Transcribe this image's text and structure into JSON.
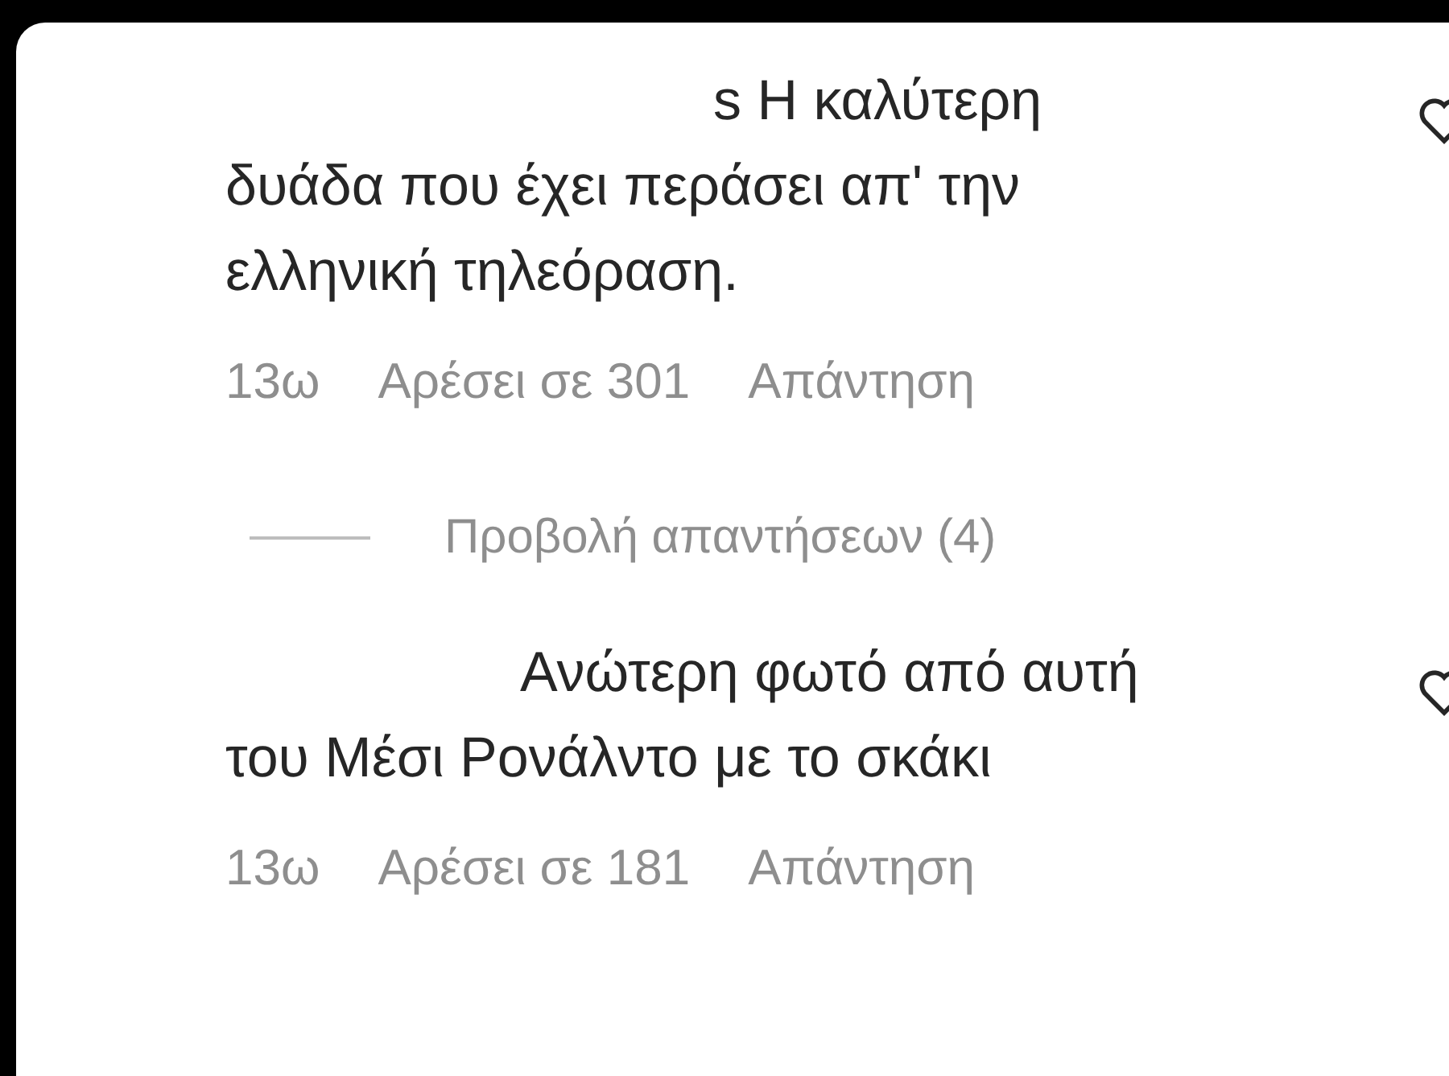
{
  "comments": [
    {
      "lines": [
        "s Η καλύτερη",
        "δυάδα που έχει περάσει απ' την",
        "ελληνική τηλεόραση."
      ],
      "time": "13ω",
      "likes": "Αρέσει σε 301",
      "reply": "Απάντηση",
      "view_replies": "Προβολή απαντήσεων (4)"
    },
    {
      "lines": [
        "Ανώτερη φωτό από αυτή",
        "του Μέσι Ρονάλντο με το σκάκι"
      ],
      "time": "13ω",
      "likes": "Αρέσει σε 181",
      "reply": "Απάντηση"
    }
  ]
}
